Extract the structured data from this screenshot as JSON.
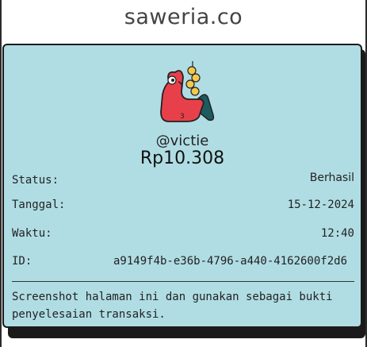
{
  "brand": {
    "name": "saweria.co"
  },
  "receipt": {
    "username": "@victie",
    "amount": "Rp10.308",
    "fields": {
      "status": {
        "label": "Status:",
        "value": "Berhasil"
      },
      "date": {
        "label": "Tanggal:",
        "value": "15-12-2024"
      },
      "time": {
        "label": "Waktu:",
        "value": "12:40"
      },
      "id": {
        "label": "ID:",
        "value": "a9149f4b-e36b-4796-a440-4162600f2d6"
      }
    },
    "note": "Screenshot halaman ini dan gunakan sebagai bukti penyelesaian transaksi."
  },
  "colors": {
    "card_background": "#b0dde4",
    "mascot_red": "#e8404a",
    "coin_yellow": "#f2c94c"
  },
  "icons": {
    "mascot": "saweria-mascot-icon"
  }
}
